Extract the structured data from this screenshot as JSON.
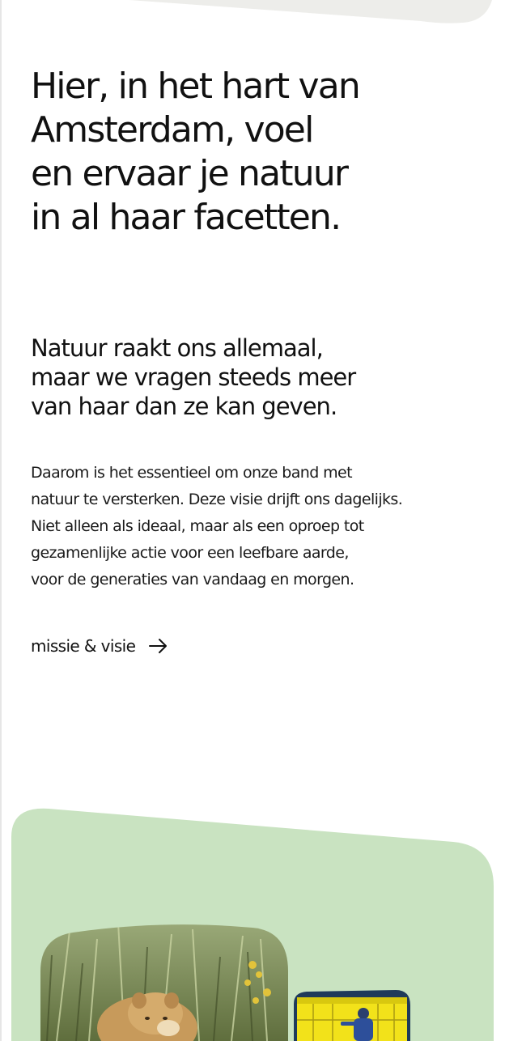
{
  "headline": {
    "lines": [
      "Hier, in het hart van",
      "Amsterdam, voel",
      "en ervaar je natuur",
      "in al haar facetten."
    ]
  },
  "subheading": {
    "lines": [
      "Natuur raakt ons allemaal,",
      "maar we vragen steeds meer",
      "van haar dan ze kan geven."
    ]
  },
  "body": {
    "lines": [
      "Daarom is het essentieel om onze band met",
      "natuur te versterken. Deze visie drijft ons dagelijks.",
      "Niet alleen als ideaal, maar als een oproep tot",
      "gezamenlijke actie voor een leefbare aarde,",
      "voor de generaties van vandaag en morgen."
    ]
  },
  "cta": {
    "label": "missie & visie",
    "icon": "arrow-right-icon"
  },
  "images": {
    "lion": {
      "icon": "lion-photo"
    },
    "museum": {
      "icon": "museum-hall-photo"
    }
  },
  "colors": {
    "text": "#111111",
    "top_band": "#ededea",
    "green_panel": "#c9e3c1",
    "museum_yellow": "#f2e21a"
  }
}
